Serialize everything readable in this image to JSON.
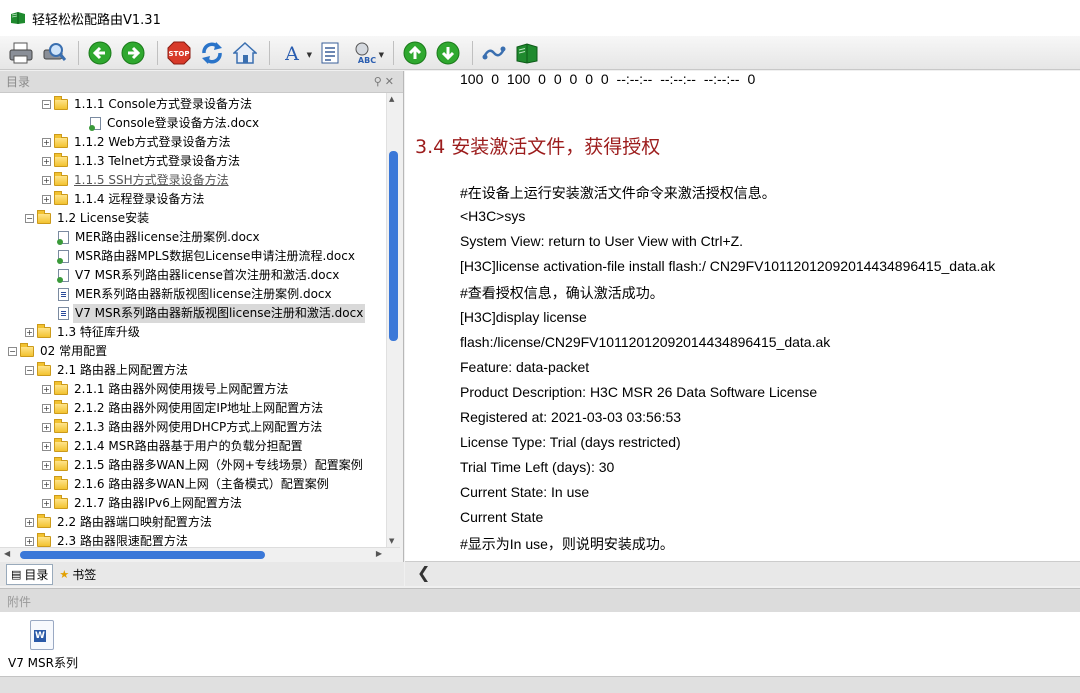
{
  "window": {
    "title": "轻轻松松配路由V1.31"
  },
  "toolbar": {
    "buttons": [
      {
        "icon": "print-icon"
      },
      {
        "icon": "print-preview-icon"
      },
      {
        "icon": "back-arrow-icon"
      },
      {
        "icon": "forward-arrow-icon"
      },
      {
        "icon": "stop-icon",
        "label": "STOP"
      },
      {
        "icon": "refresh-icon"
      },
      {
        "icon": "home-icon"
      },
      {
        "icon": "font-icon",
        "label": "A"
      },
      {
        "icon": "notes-icon"
      },
      {
        "icon": "spell-check-icon",
        "label": "ABC"
      },
      {
        "icon": "up-arrow-icon"
      },
      {
        "icon": "down-arrow-icon"
      },
      {
        "icon": "link-icon"
      },
      {
        "icon": "book-icon"
      }
    ],
    "colors": {
      "green": "#2fa82f",
      "stop_red": "#d83a2a"
    }
  },
  "left_pane": {
    "header": "目录",
    "tree": [
      {
        "label": "1.1.1 Console方式登录设备方法",
        "kind": "folder",
        "expander": "minus",
        "level": 2
      },
      {
        "label": "Console登录设备方法.docx",
        "kind": "doc-leaf",
        "level": 3
      },
      {
        "label": "1.1.2 Web方式登录设备方法",
        "kind": "folder",
        "expander": "plus",
        "level": 2
      },
      {
        "label": "1.1.3 Telnet方式登录设备方法",
        "kind": "folder",
        "expander": "plus",
        "level": 2
      },
      {
        "label": "1.1.5 SSH方式登录设备方法",
        "kind": "folder",
        "expander": "plus",
        "level": 2,
        "style": "link"
      },
      {
        "label": "1.1.4 远程登录设备方法",
        "kind": "folder",
        "expander": "plus",
        "level": 2
      },
      {
        "label": "1.2 License安装",
        "kind": "folder",
        "expander": "minus",
        "level": 1
      },
      {
        "label": "MER路由器license注册案例.docx",
        "kind": "doc-leaf",
        "level": 2
      },
      {
        "label": "MSR路由器MPLS数据包License申请注册流程.docx",
        "kind": "doc-leaf",
        "level": 2
      },
      {
        "label": "V7 MSR系列路由器license首次注册和激活.docx",
        "kind": "doc-leaf",
        "level": 2
      },
      {
        "label": "MER系列路由器新版视图license注册案例.docx",
        "kind": "doc-page",
        "level": 2
      },
      {
        "label": "V7 MSR系列路由器新版视图license注册和激活.docx",
        "kind": "doc-page",
        "level": 2,
        "selected": true
      },
      {
        "label": "1.3 特征库升级",
        "kind": "folder",
        "expander": "plus",
        "level": 1
      },
      {
        "label": "02 常用配置",
        "kind": "folder",
        "expander": "minus",
        "level": 0
      },
      {
        "label": "2.1 路由器上网配置方法",
        "kind": "folder",
        "expander": "minus",
        "level": 1
      },
      {
        "label": "2.1.1 路由器外网使用拨号上网配置方法",
        "kind": "folder",
        "expander": "plus",
        "level": 2
      },
      {
        "label": "2.1.2 路由器外网使用固定IP地址上网配置方法",
        "kind": "folder",
        "expander": "plus",
        "level": 2
      },
      {
        "label": "2.1.3 路由器外网使用DHCP方式上网配置方法",
        "kind": "folder",
        "expander": "plus",
        "level": 2
      },
      {
        "label": "2.1.4 MSR路由器基于用户的负载分担配置",
        "kind": "folder",
        "expander": "plus",
        "level": 2
      },
      {
        "label": "2.1.5 路由器多WAN上网（外网+专线场景）配置案例",
        "kind": "folder",
        "expander": "plus",
        "level": 2
      },
      {
        "label": "2.1.6 路由器多WAN上网（主备模式）配置案例",
        "kind": "folder",
        "expander": "plus",
        "level": 2
      },
      {
        "label": "2.1.7 路由器IPv6上网配置方法",
        "kind": "folder",
        "expander": "plus",
        "level": 2
      },
      {
        "label": "2.2 路由器端口映射配置方法",
        "kind": "folder",
        "expander": "plus",
        "level": 1
      },
      {
        "label": "2.3 路由器限速配置方法",
        "kind": "folder",
        "expander": "plus",
        "level": 1
      }
    ],
    "tabs": [
      {
        "label": "目录",
        "icon": "toc-icon",
        "active": true
      },
      {
        "label": "书签",
        "icon": "bookmark-star-icon",
        "active": false
      }
    ]
  },
  "content": {
    "top_row": "100    0 100    0    0    0     0    0 --:--:-- --:--:-- --:--:--     0",
    "section_title": "3.4  安装激活文件，获得授权",
    "lines": [
      "#在设备上运行安装激活文件命令来激活授权信息。",
      "<H3C>sys",
      "System View: return to User View with Ctrl+Z.",
      "[H3C]license activation-file install  flash:/ CN29FV1011201209201443489641​5_data.ak",
      "#查看授权信息，确认激活成功。",
      "[H3C]display license",
      "flash:/license/CN29FV1011201209201443489641​5_data.ak",
      "Feature: data-packet",
      "Product Description: H3C MSR 26 Data Software License",
      "Registered at: 2021-03-03 03:56:53",
      "License Type: Trial (days restricted)",
      "Trial Time Left (days): 30",
      "Current State: In use",
      "Current State",
      "#显示为In use，则说明安装成功。"
    ]
  },
  "attachments": {
    "header": "附件",
    "items": [
      {
        "caption": "V7 MSR系列",
        "icon": "word-doc-icon"
      }
    ]
  }
}
